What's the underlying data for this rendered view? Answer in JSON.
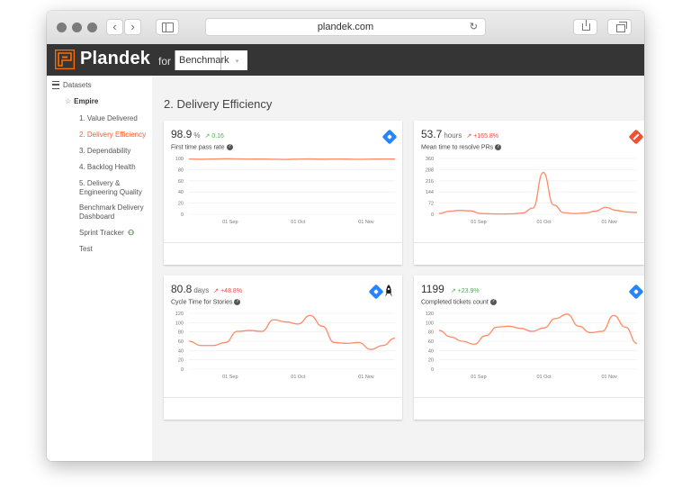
{
  "browser": {
    "url": "plandek.com"
  },
  "app": {
    "brand": "Plandek",
    "brand_for": "for",
    "dataset": "Benchmark"
  },
  "sidebar": {
    "datasets_label": "Datasets",
    "group_label": "Empire",
    "items": [
      {
        "label": "1. Value Delivered",
        "active": false
      },
      {
        "label": "2. Delivery Efficiency",
        "active": true
      },
      {
        "label": "3. Dependability",
        "active": false
      },
      {
        "label": "4. Backlog Health",
        "active": false
      },
      {
        "label_line1": "5. Delivery &",
        "label_line2": "Engineering Quality",
        "active": false
      },
      {
        "label_line1": "Benchmark Delivery",
        "label_line2": "Dashboard",
        "active": false
      },
      {
        "label": "Sprint Tracker",
        "active": false
      },
      {
        "label": "Test",
        "active": false
      }
    ]
  },
  "page": {
    "title": "2. Delivery Efficiency"
  },
  "colors": {
    "accent": "#ff7043",
    "line": "#ff8a65",
    "positive": "#4caf50",
    "negative": "#f44336",
    "jira": "#2684ff",
    "git": "#f05133"
  },
  "cards": [
    {
      "value": "98.9",
      "unit": "%",
      "delta": "0.16",
      "delta_dir": "green",
      "label": "First time pass rate",
      "icons": [
        "jira-icon"
      ],
      "chart_data": {
        "type": "line",
        "yticks": [
          "100",
          "80",
          "60",
          "40",
          "20",
          "0"
        ],
        "ylim": [
          0,
          100
        ],
        "xticks": [
          "01 Sep",
          "01 Oct",
          "01 Nov"
        ],
        "values": [
          99,
          98.5,
          99,
          99.5,
          99.2,
          98.8,
          99,
          98.6,
          98.2,
          98.8,
          99.1,
          98.7,
          99,
          98.9,
          98.4,
          98.8,
          99,
          98.9
        ]
      }
    },
    {
      "value": "53.7",
      "unit": "hours",
      "delta": "+165.8%",
      "delta_dir": "red",
      "label": "Mean time to resolve PRs",
      "icons": [
        "git-icon"
      ],
      "chart_data": {
        "type": "line",
        "yticks": [
          "360",
          "288",
          "216",
          "144",
          "72",
          "0"
        ],
        "ylim": [
          0,
          360
        ],
        "xticks": [
          "01 Sep",
          "01 Oct",
          "01 Nov"
        ],
        "values": [
          5,
          20,
          25,
          22,
          5,
          3,
          2,
          3,
          8,
          40,
          270,
          60,
          10,
          5,
          8,
          20,
          45,
          25,
          15,
          12
        ]
      }
    },
    {
      "value": "80.8",
      "unit": "days",
      "delta": "+48.8%",
      "delta_dir": "red",
      "label": "Cycle Time for Stories",
      "icons": [
        "jira-icon",
        "rocket-icon"
      ],
      "chart_data": {
        "type": "line",
        "yticks": [
          "120",
          "100",
          "80",
          "60",
          "40",
          "20",
          "0"
        ],
        "ylim": [
          0,
          130
        ],
        "xticks": [
          "01 Sep",
          "01 Oct",
          "01 Nov"
        ],
        "values": [
          65,
          55,
          55,
          62,
          88,
          90,
          88,
          115,
          110,
          105,
          125,
          100,
          62,
          60,
          62,
          46,
          55,
          72
        ]
      }
    },
    {
      "value": "1199",
      "unit": "",
      "delta": "+23.9%",
      "delta_dir": "green",
      "label": "Completed tickets count",
      "icons": [
        "jira-icon"
      ],
      "chart_data": {
        "type": "line",
        "yticks": [
          "120",
          "100",
          "80",
          "60",
          "40",
          "20",
          "0"
        ],
        "ylim": [
          0,
          130
        ],
        "xticks": [
          "01 Sep",
          "01 Oct",
          "01 Nov"
        ],
        "values": [
          90,
          75,
          65,
          58,
          78,
          98,
          100,
          95,
          88,
          96,
          118,
          128,
          100,
          85,
          88,
          125,
          98,
          60
        ]
      }
    }
  ]
}
